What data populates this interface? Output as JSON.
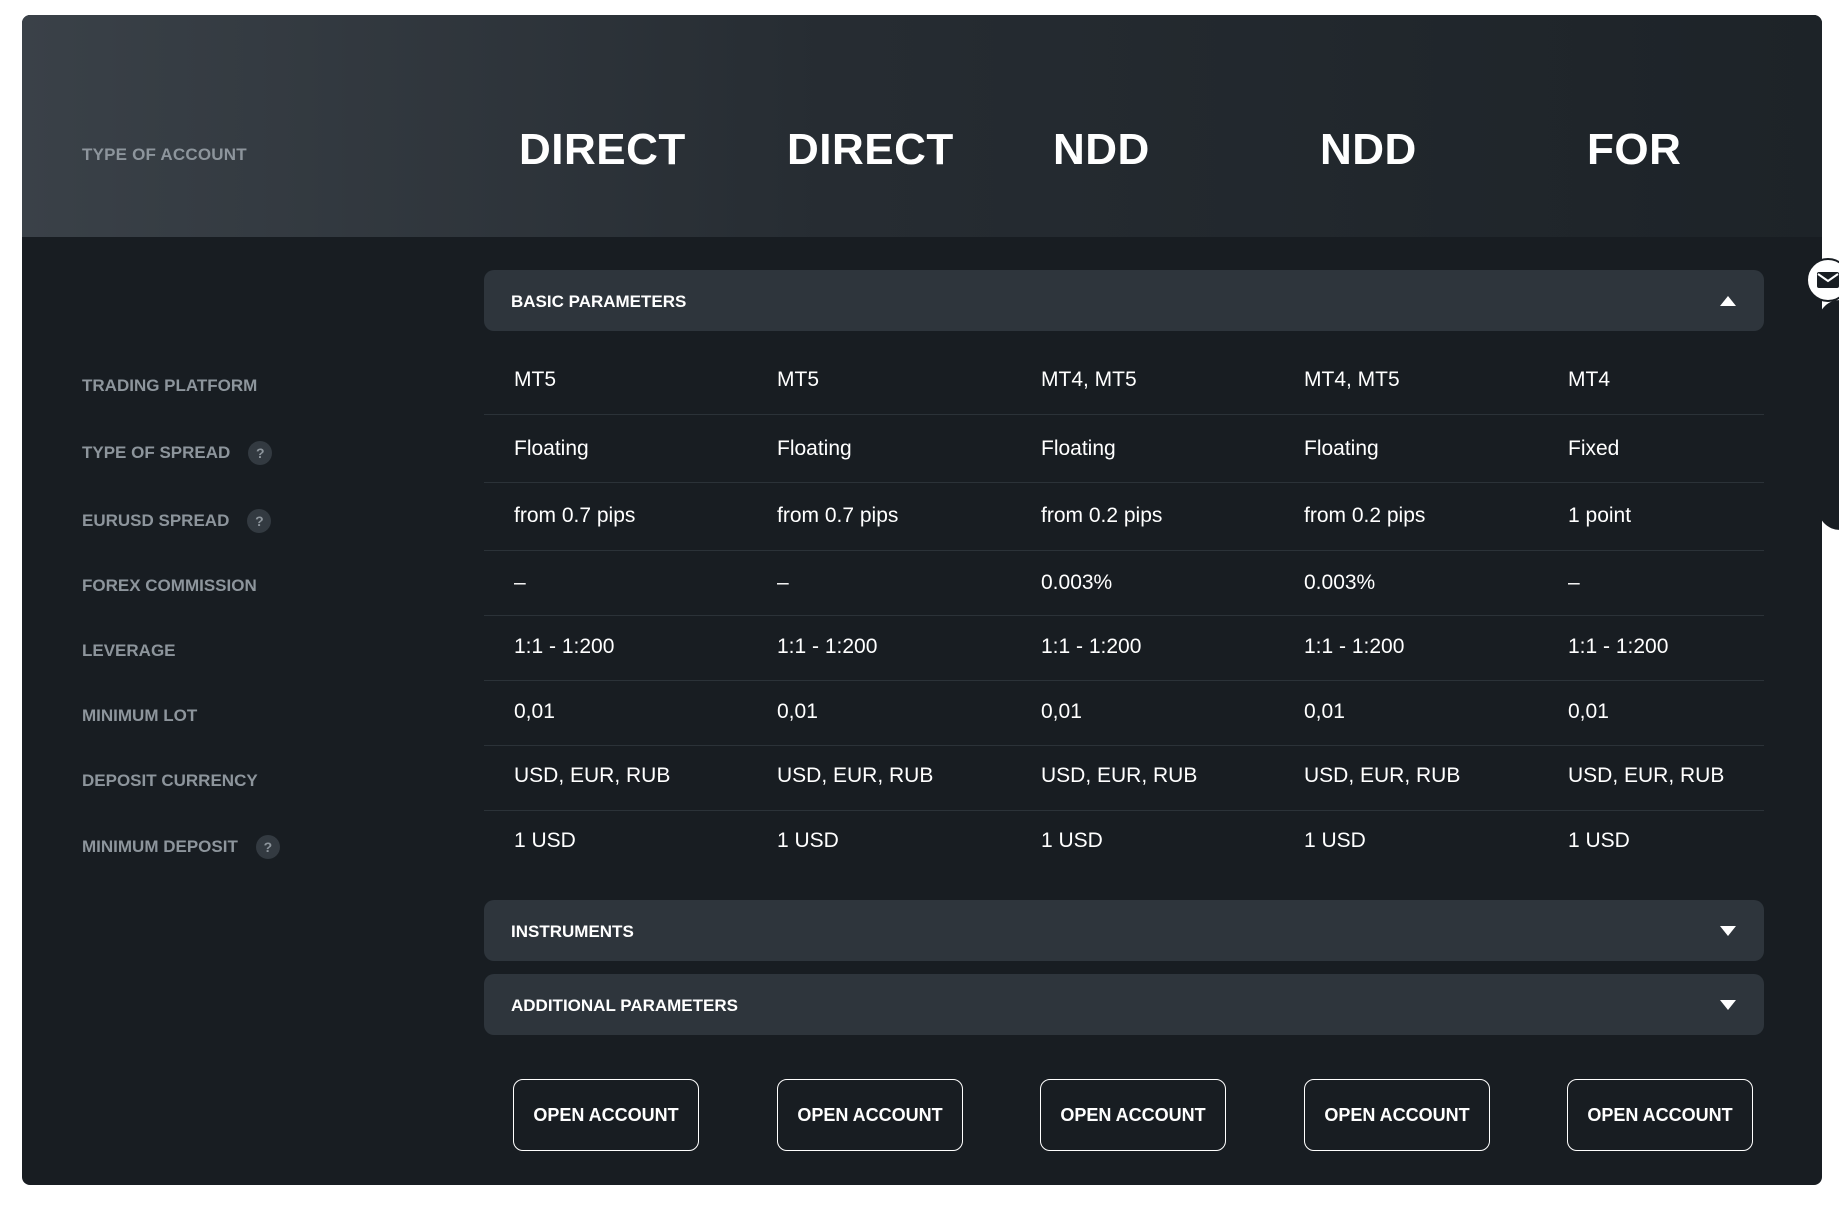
{
  "header": {
    "type_label": "TYPE OF ACCOUNT",
    "accounts": [
      "DIRECT",
      "DIRECT",
      "NDD",
      "NDD",
      "FOR"
    ]
  },
  "sections": {
    "basic": {
      "title": "BASIC PARAMETERS",
      "expanded": true
    },
    "instruments": {
      "title": "INSTRUMENTS",
      "expanded": false
    },
    "additional": {
      "title": "ADDITIONAL PARAMETERS",
      "expanded": false
    }
  },
  "rows": [
    {
      "label": "TRADING PLATFORM",
      "help": false,
      "values": [
        "MT5",
        "MT5",
        "MT4, MT5",
        "MT4, MT5",
        "MT4"
      ]
    },
    {
      "label": "TYPE OF SPREAD",
      "help": true,
      "values": [
        "Floating",
        "Floating",
        "Floating",
        "Floating",
        "Fixed"
      ]
    },
    {
      "label": "EURUSD SPREAD",
      "help": true,
      "values": [
        "from 0.7 pips",
        "from 0.7 pips",
        "from 0.2 pips",
        "from 0.2 pips",
        "1 point"
      ]
    },
    {
      "label": "FOREX COMMISSION",
      "help": false,
      "values": [
        "–",
        "–",
        "0.003%",
        "0.003%",
        "–"
      ]
    },
    {
      "label": "LEVERAGE",
      "help": false,
      "values": [
        "1:1 - 1:200",
        "1:1 - 1:200",
        "1:1 - 1:200",
        "1:1 - 1:200",
        "1:1 - 1:200"
      ]
    },
    {
      "label": "MINIMUM LOT",
      "help": false,
      "values": [
        "0,01",
        "0,01",
        "0,01",
        "0,01",
        "0,01"
      ]
    },
    {
      "label": "DEPOSIT CURRENCY",
      "help": false,
      "values": [
        "USD, EUR, RUB",
        "USD, EUR, RUB",
        "USD, EUR, RUB",
        "USD, EUR, RUB",
        "USD, EUR, RUB"
      ]
    },
    {
      "label": "MINIMUM DEPOSIT",
      "help": true,
      "values": [
        "1 USD",
        "1 USD",
        "1 USD",
        "1 USD",
        "1 USD"
      ]
    }
  ],
  "help_glyph": "?",
  "buttons": {
    "open_account": [
      "OPEN ACCOUNT",
      "OPEN ACCOUNT",
      "OPEN ACCOUNT",
      "OPEN ACCOUNT",
      "OPEN ACCOUNT"
    ]
  },
  "icons": {
    "help": "question-icon",
    "collapse": "caret-up-icon",
    "expand": "caret-down-icon",
    "side_widget": "mail-icon"
  },
  "colors": {
    "card_bg": "#181d22",
    "section_bar": "#2e353c",
    "label_text": "#8d959c",
    "value_text": "#ffffff"
  }
}
